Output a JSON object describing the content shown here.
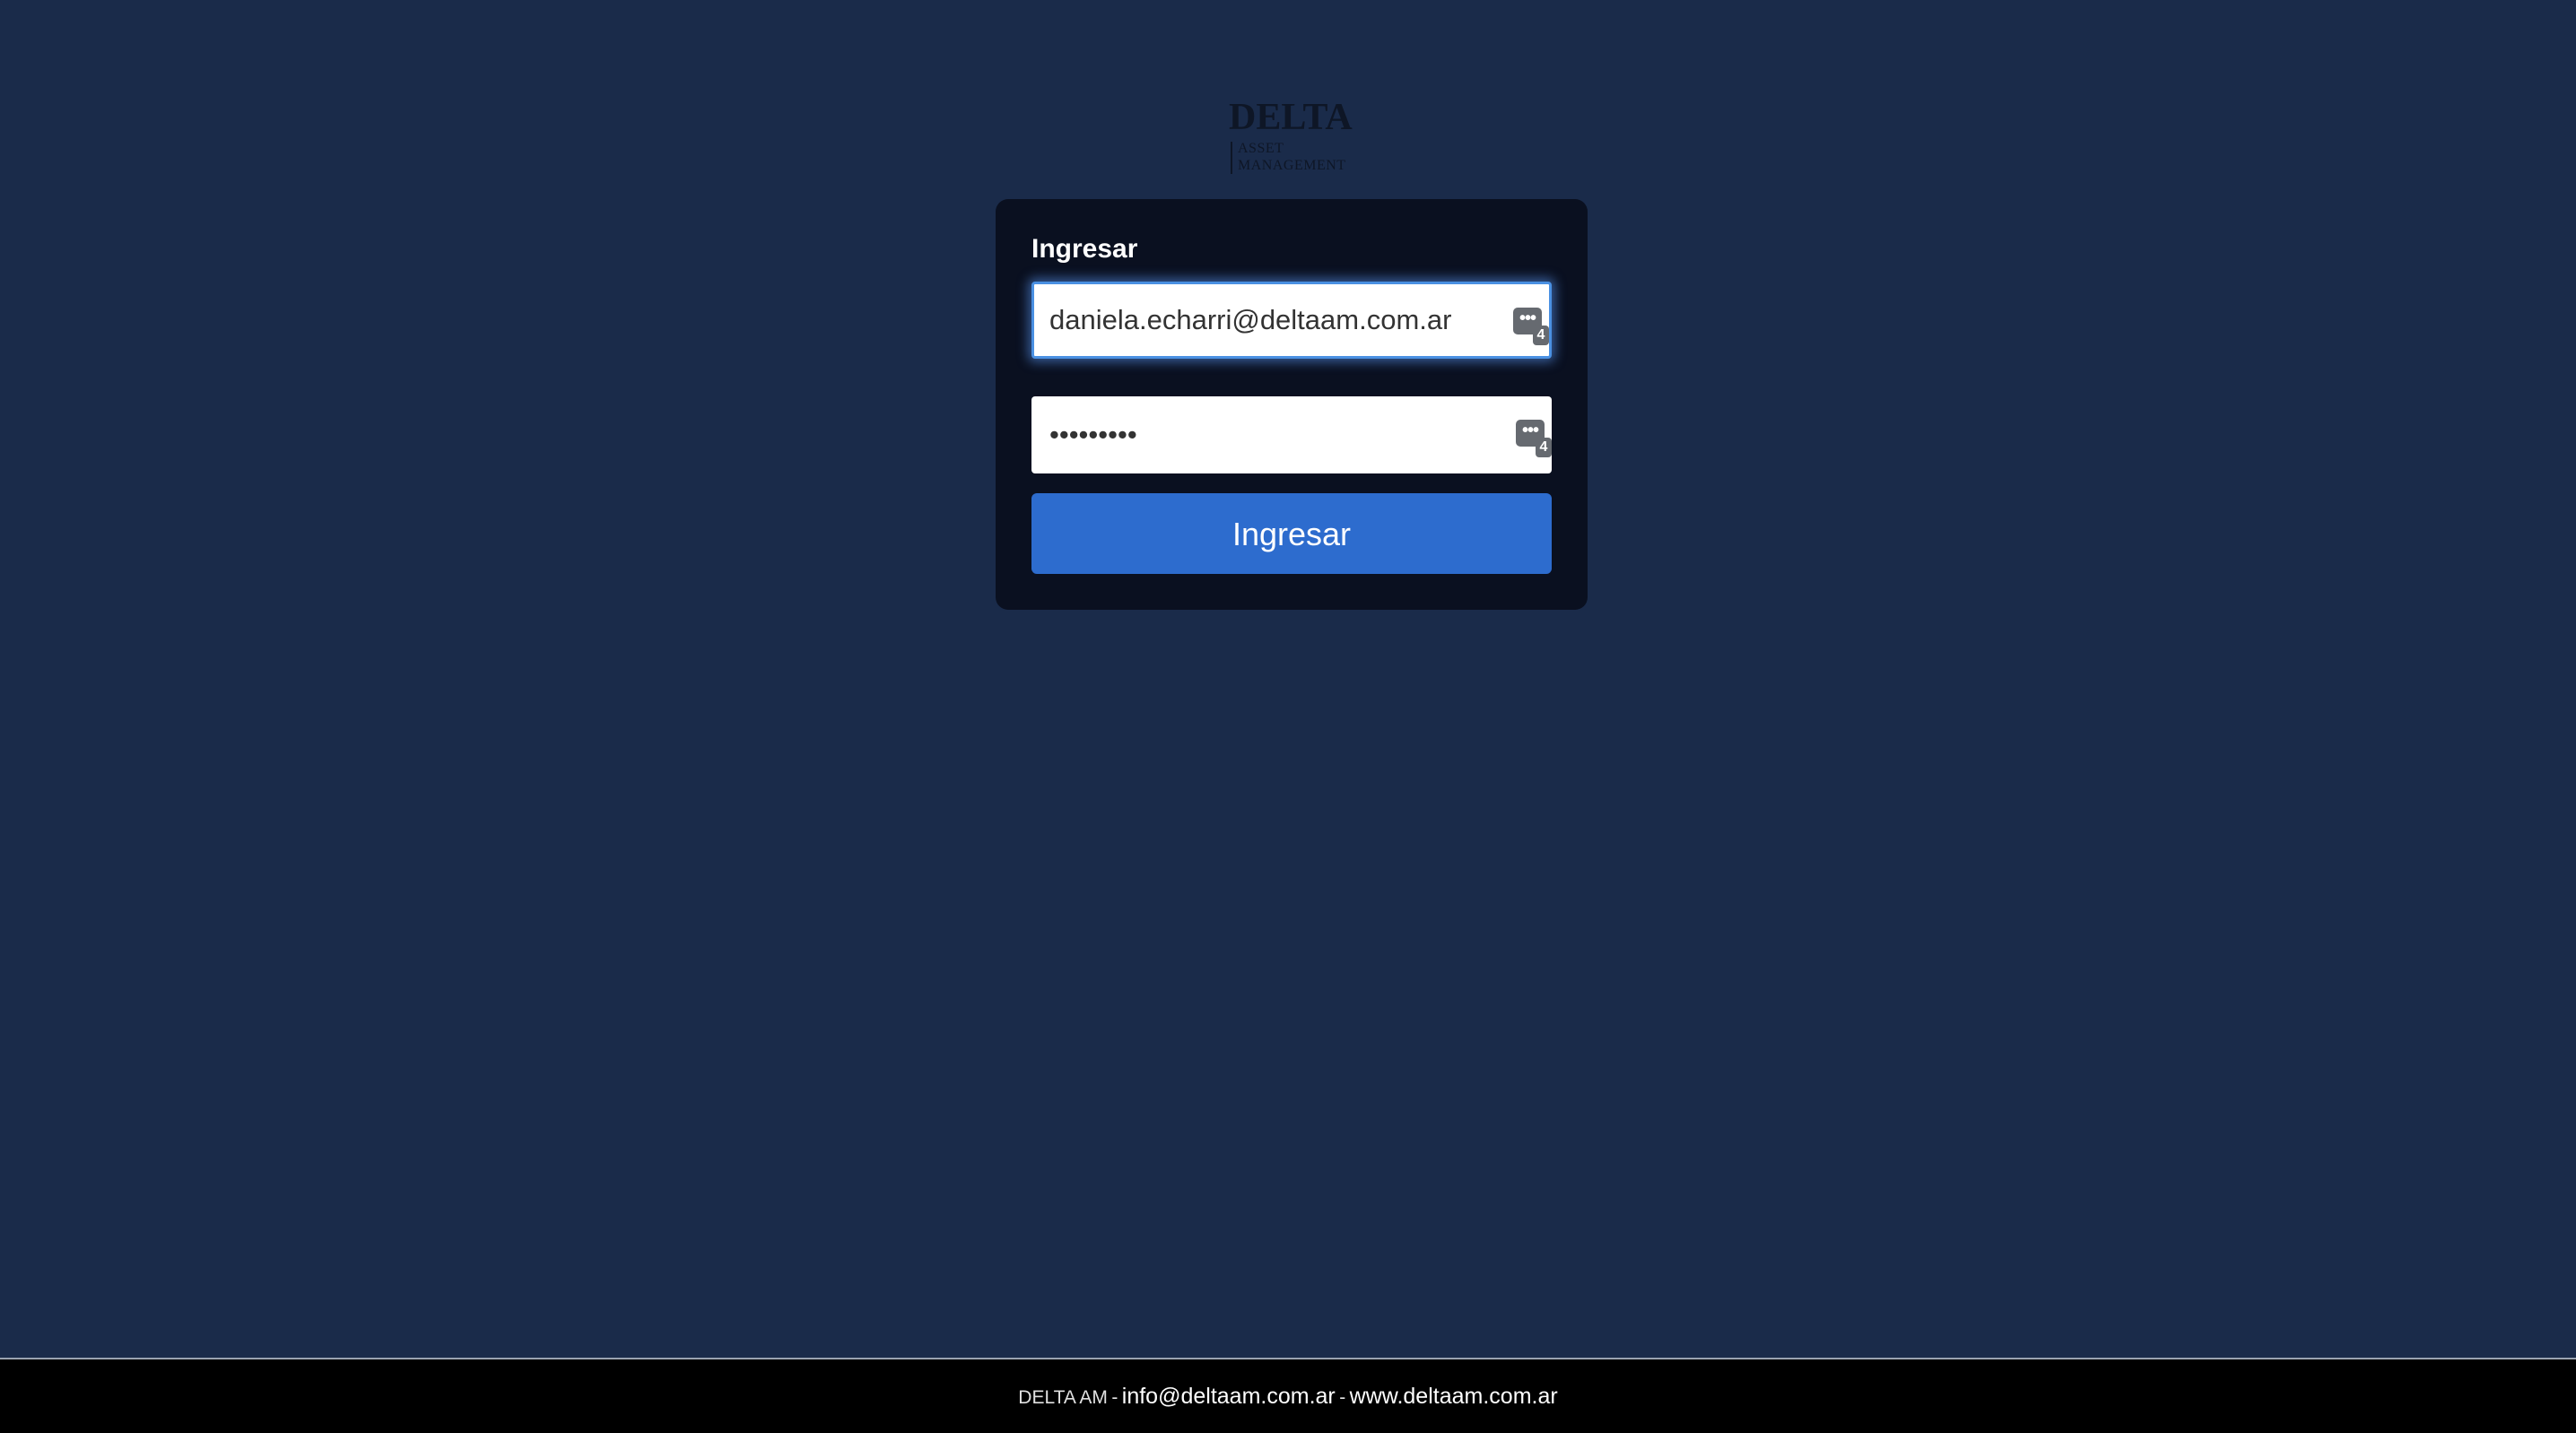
{
  "logo": {
    "word": "DELTA",
    "sub_line1": "ASSET",
    "sub_line2": "MANAGEMENT"
  },
  "login": {
    "title": "Ingresar",
    "email_value": "daniela.echarri@deltaam.com.ar",
    "password_value": "123456789",
    "password_manager_badge": "•••",
    "password_manager_count": "4",
    "submit_label": "Ingresar"
  },
  "footer": {
    "brand": "DELTA AM",
    "separator": "-",
    "email": "info@deltaam.com.ar",
    "website": "www.deltaam.com.ar"
  },
  "colors": {
    "background": "#1a2b4a",
    "card": "#0a1020",
    "button": "#2d6cce",
    "focus_ring": "#4a90e2",
    "footer": "#000000"
  }
}
